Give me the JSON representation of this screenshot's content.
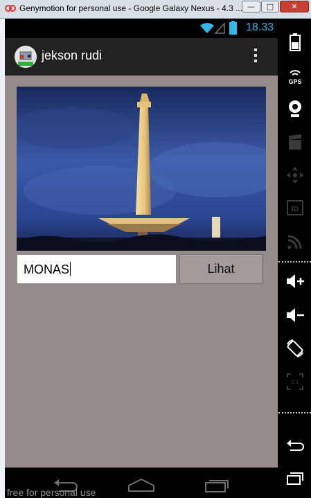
{
  "window": {
    "title": "Genymotion for personal use - Google Galaxy Nexus - 4.3 ...",
    "minimize_glyph": "—",
    "maximize_glyph": "□",
    "close_glyph": "✕"
  },
  "statusbar": {
    "time": "18.33"
  },
  "actionbar": {
    "app_title": "jekson rudi"
  },
  "form": {
    "input_value": "MONAS",
    "button_label": "Lihat"
  },
  "watermark": "free for personal use",
  "sidebar": {
    "icons": [
      "battery-icon",
      "gps-icon",
      "webcam-icon",
      "clapperboard-icon",
      "dpad-icon",
      "id-icon",
      "cast-icon",
      "volume-up-icon",
      "volume-down-icon",
      "rotate-icon",
      "scale-icon",
      "back-icon",
      "recent-apps-icon"
    ],
    "gps_label": "GPS",
    "id_label": "ID",
    "scale_label": "1:1"
  },
  "colors": {
    "content_bg": "#968b8b",
    "time_color": "#33b5e5",
    "actionbar_bg": "#222222"
  }
}
